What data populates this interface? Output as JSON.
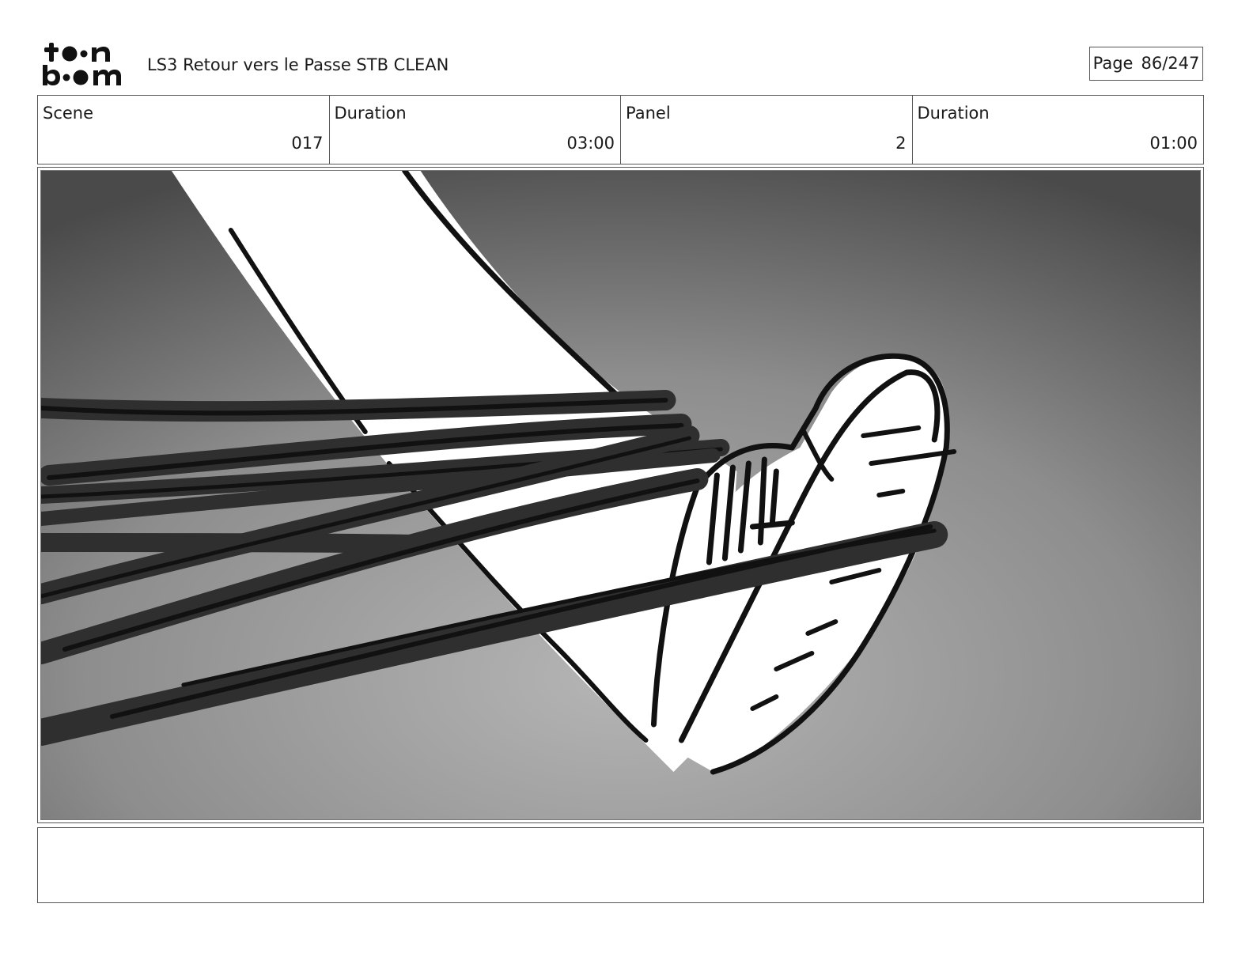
{
  "header": {
    "brand": "toon boom",
    "document_title": "LS3 Retour vers le Passe STB CLEAN",
    "page": {
      "label": "Page",
      "value": "86/247"
    }
  },
  "info": {
    "scene_label": "Scene",
    "scene_value": "017",
    "scene_duration_label": "Duration",
    "scene_duration_value": "03:00",
    "panel_label": "Panel",
    "panel_value": "2",
    "panel_duration_label": "Duration",
    "panel_duration_value": "01:00"
  },
  "panel_image": {
    "subject": "sketch-foot-sneaker-closeup",
    "colors": {
      "background_light": "#b3b3b3",
      "background_dark": "#4a4a4a",
      "ink": "#111111",
      "tone": "#2f2f2f"
    }
  },
  "notes": {
    "text": ""
  }
}
